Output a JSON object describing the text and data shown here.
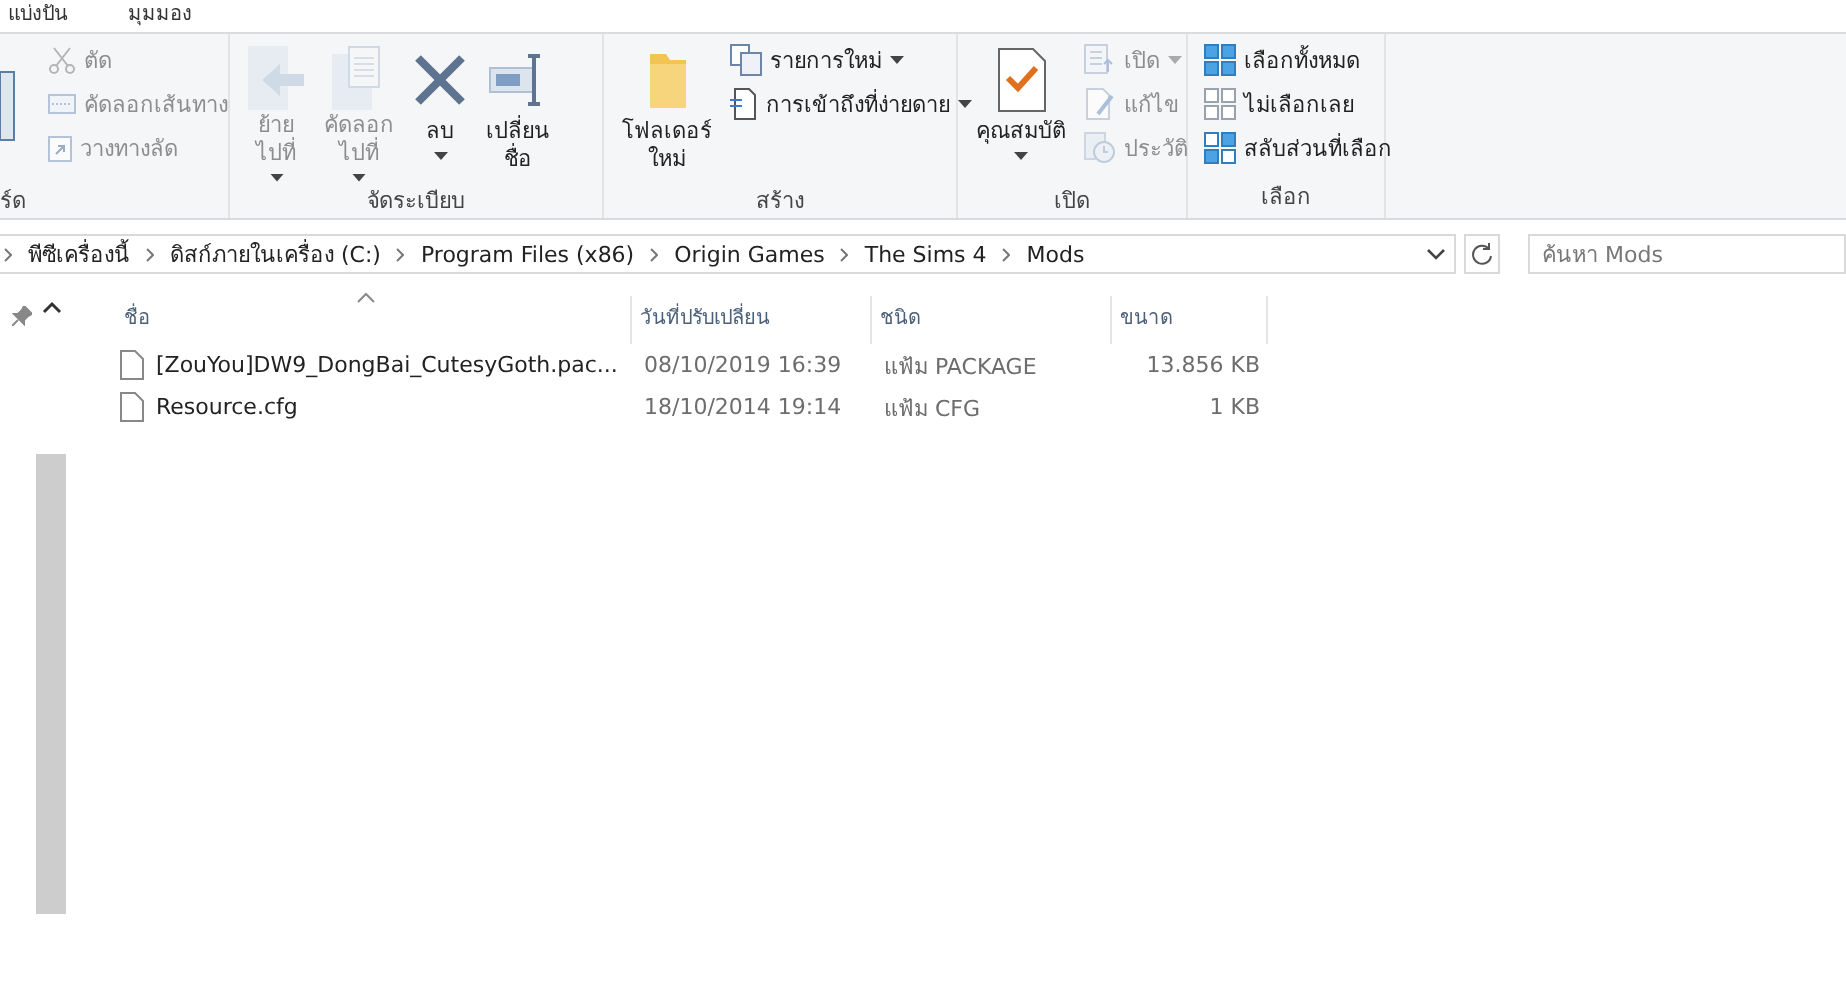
{
  "tabs": [
    {
      "label": "แบ่งปัน",
      "selected": false
    },
    {
      "label": "มุมมอง",
      "selected": false
    }
  ],
  "ribbon": {
    "groups": [
      {
        "label": "ร์ด",
        "items": [
          {
            "kind": "cutoff"
          },
          {
            "kind": "small",
            "label": "ตัด",
            "disabled": true,
            "dropdown": false
          },
          {
            "kind": "small",
            "label": "คัดลอกเส้นทาง",
            "disabled": true,
            "dropdown": false
          },
          {
            "kind": "small",
            "label": "วางทางลัด",
            "disabled": true,
            "dropdown": false
          }
        ]
      },
      {
        "label": "จัดระเบียบ",
        "items": [
          {
            "kind": "large",
            "label": "ย้าย\nไปที่",
            "disabled": true,
            "dropdown": true
          },
          {
            "kind": "large",
            "label": "คัดลอก\nไปที่",
            "disabled": true,
            "dropdown": true
          },
          {
            "kind": "large",
            "label": "ลบ",
            "disabled": false,
            "dropdown": true
          },
          {
            "kind": "large",
            "label": "เปลี่ยน\nชื่อ",
            "disabled": false,
            "dropdown": false
          }
        ]
      },
      {
        "label": "สร้าง",
        "items": [
          {
            "kind": "large",
            "label": "โฟลเดอร์\nใหม่",
            "disabled": false,
            "dropdown": false
          },
          {
            "kind": "small",
            "label": "รายการใหม่",
            "disabled": false,
            "dropdown": true
          },
          {
            "kind": "small",
            "label": "การเข้าถึงที่ง่ายดาย",
            "disabled": false,
            "dropdown": true
          }
        ]
      },
      {
        "label": "เปิด",
        "items": [
          {
            "kind": "large",
            "label": "คุณสมบัติ",
            "disabled": false,
            "dropdown": true
          },
          {
            "kind": "small",
            "label": "เปิด",
            "disabled": true,
            "dropdown": true
          },
          {
            "kind": "small",
            "label": "แก้ไข",
            "disabled": true,
            "dropdown": false
          },
          {
            "kind": "small",
            "label": "ประวัติ",
            "disabled": true,
            "dropdown": false
          }
        ]
      },
      {
        "label": "เลือก",
        "items": [
          {
            "kind": "small",
            "label": "เลือกทั้งหมด",
            "disabled": false,
            "dropdown": false
          },
          {
            "kind": "small",
            "label": "ไม่เลือกเลย",
            "disabled": false,
            "dropdown": false
          },
          {
            "kind": "small",
            "label": "สลับส่วนที่เลือก",
            "disabled": false,
            "dropdown": false
          }
        ]
      }
    ]
  },
  "address_bar": {
    "crumbs": [
      "พีซีเครื่องนี้",
      "ดิสก์ภายในเครื่อง (C:)",
      "Program Files (x86)",
      "Origin Games",
      "The Sims 4",
      "Mods"
    ]
  },
  "search": {
    "placeholder": "ค้นหา Mods"
  },
  "table": {
    "columns": [
      "ชื่อ",
      "วันที่ปรับเปลี่ยน",
      "ชนิด",
      "ขนาด"
    ],
    "rows": [
      {
        "name": "[ZouYou]DW9_DongBai_CutesyGoth.pac...",
        "date": "08/10/2019 16:39",
        "type": "แฟ้ม PACKAGE",
        "size": "13.856 KB"
      },
      {
        "name": "Resource.cfg",
        "date": "18/10/2014 19:14",
        "type": "แฟ้ม CFG",
        "size": "1 KB"
      }
    ]
  }
}
